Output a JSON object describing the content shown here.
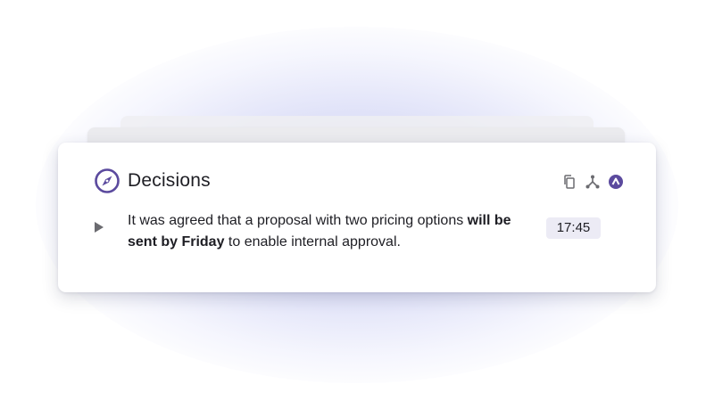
{
  "card": {
    "title": "Decisions",
    "icon": "compass-icon",
    "accent_color": "#5b4a9e",
    "actions": [
      {
        "icon": "copy-icon",
        "label": "Copy"
      },
      {
        "icon": "fork-icon",
        "label": "Branch"
      },
      {
        "icon": "upvote-icon",
        "label": "Upvote"
      }
    ],
    "item": {
      "text_before": "It was agreed that a proposal with two pricing options ",
      "text_bold": "will be sent by Friday",
      "text_after": " to enable internal approval.",
      "timestamp": "17:45",
      "expand_icon": "play-triangle-icon"
    }
  }
}
